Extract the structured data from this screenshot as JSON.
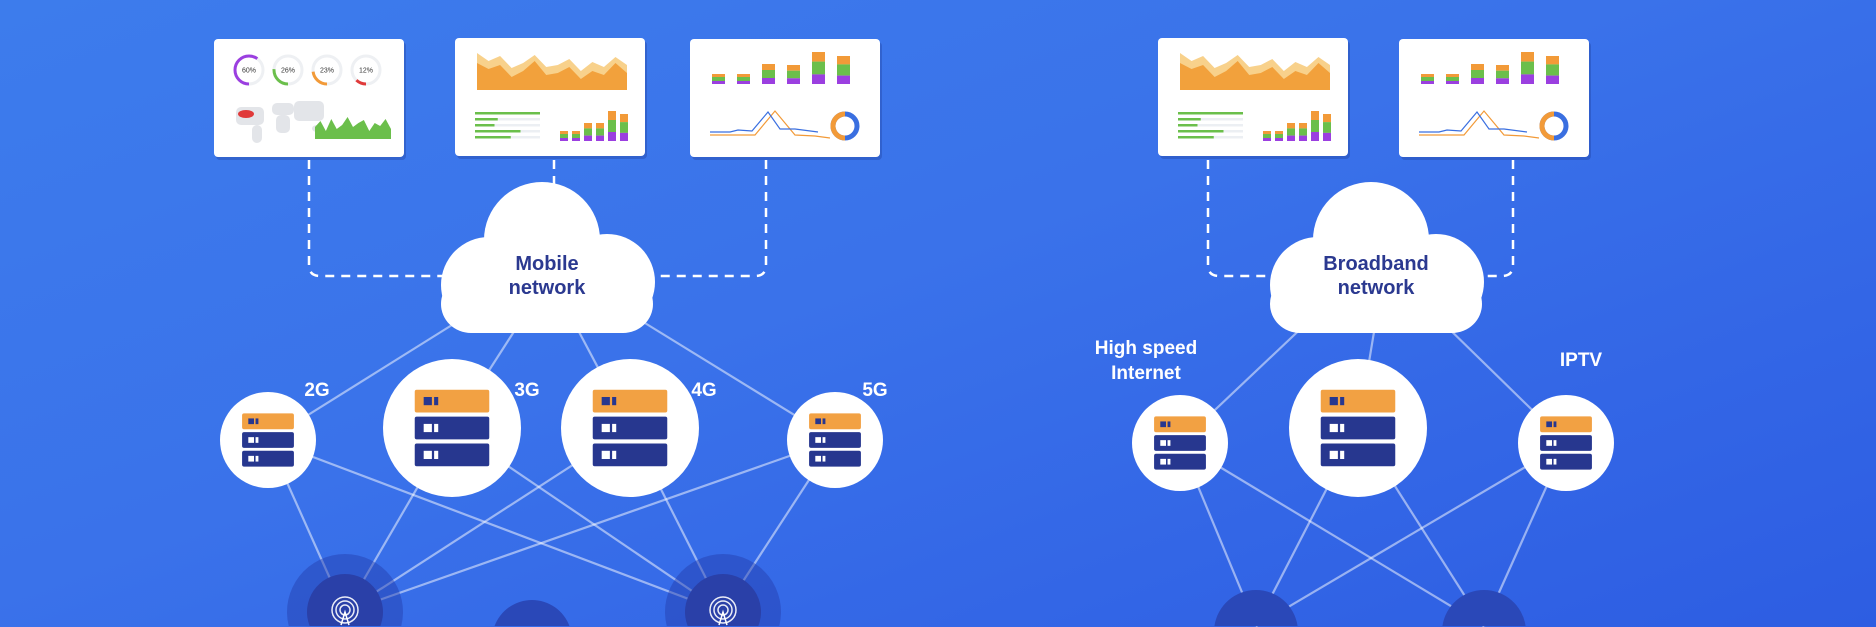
{
  "colors": {
    "background": "#3a72ea",
    "cloud_text": "#2b3990",
    "server_top": "#f2a143",
    "server_body": "#27378f",
    "purple": "#9b3fe0",
    "green": "#6bbf4b",
    "orange": "#f29a38",
    "red": "#e03a3a"
  },
  "mobile": {
    "cloud_line1": "Mobile",
    "cloud_line2": "network",
    "dashboard_gauges": [
      "60%",
      "26%",
      "23%",
      "12%"
    ],
    "nodes": [
      {
        "label": "2G"
      },
      {
        "label": "3G"
      },
      {
        "label": "4G"
      },
      {
        "label": "5G"
      }
    ],
    "tower_icon": "antenna-icon"
  },
  "broadband": {
    "cloud_line1": "Broadband",
    "cloud_line2": "network",
    "nodes": [
      {
        "label_line1": "High speed",
        "label_line2": "Internet"
      },
      {
        "label_line1": "",
        "label_line2": ""
      },
      {
        "label_line1": "IPTV",
        "label_line2": ""
      }
    ]
  }
}
